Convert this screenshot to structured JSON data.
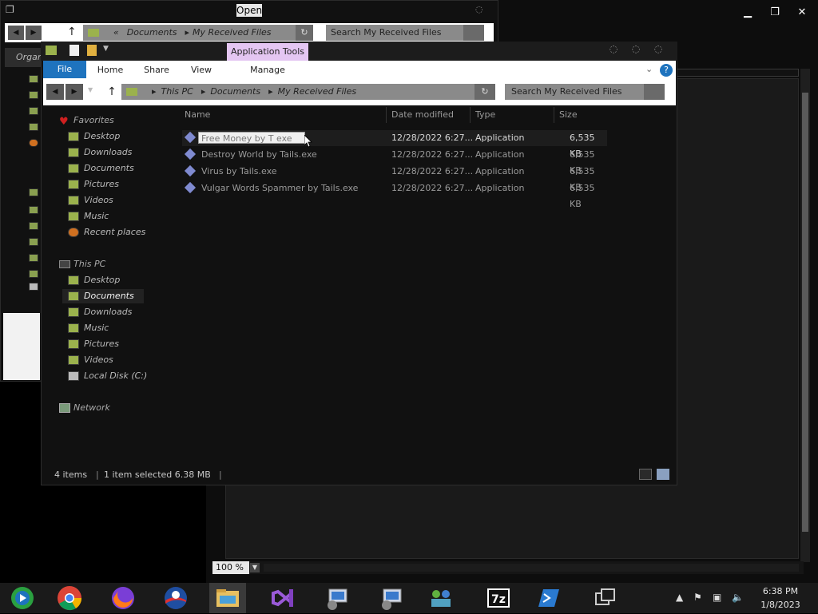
{
  "open_dialog": {
    "title": "Open",
    "breadcrumb": [
      "«",
      "Documents",
      "My Received Files"
    ],
    "search_placeholder": "Search My Received Files",
    "toolbar_label": "Organ"
  },
  "explorer": {
    "ribbon": {
      "file_tab": "File",
      "tabs": [
        "Home",
        "Share",
        "View"
      ],
      "context_group": "Application Tools",
      "context_tab": "Manage"
    },
    "breadcrumb": [
      "This PC",
      "Documents",
      "My Received Files"
    ],
    "search_placeholder": "Search My Received Files",
    "nav": {
      "favorites_header": "Favorites",
      "favorites": [
        "Desktop",
        "Downloads",
        "Documents",
        "Pictures",
        "Videos",
        "Music",
        "Recent places"
      ],
      "this_pc_header": "This PC",
      "this_pc": [
        "Desktop",
        "Documents",
        "Downloads",
        "Music",
        "Pictures",
        "Videos",
        "Local Disk (C:)"
      ],
      "network": "Network",
      "selected": "Documents"
    },
    "columns": {
      "name": "Name",
      "date": "Date modified",
      "type": "Type",
      "size": "Size"
    },
    "files": [
      {
        "name": "Free Money by T",
        "rename_value": "Free Money by T exe",
        "date": "12/28/2022 6:27...",
        "type": "Application",
        "size": "6,535 KB",
        "selected": true
      },
      {
        "name": "Destroy World by Tails.exe",
        "date": "12/28/2022 6:27...",
        "type": "Application",
        "size": "6,535 KB"
      },
      {
        "name": "Virus by Tails.exe",
        "date": "12/28/2022 6:27...",
        "type": "Application",
        "size": "6,535 KB"
      },
      {
        "name": "Vulgar Words Spammer by Tails.exe",
        "date": "12/28/2022 6:27...",
        "type": "Application",
        "size": "6,535 KB"
      }
    ],
    "status": {
      "items": "4 items",
      "selected": "1 item selected  6.38 MB"
    }
  },
  "editor": {
    "zoom": "100 %"
  },
  "taskbar": {
    "apps": [
      "media-player-icon",
      "chrome-icon",
      "firefox-icon",
      "obama-icon",
      "file-explorer-icon",
      "visual-studio-icon",
      "remote-desktop-icon",
      "remote-desktop-icon-2",
      "network-users-icon",
      "7zip-icon",
      "powershell-icon",
      "task-view-icon"
    ],
    "time": "6:38 PM",
    "date": "1/8/2023"
  },
  "colors": {
    "accent": "#1e73be",
    "context_tab": "#e4c6f2",
    "folder": "#9bb24d"
  }
}
